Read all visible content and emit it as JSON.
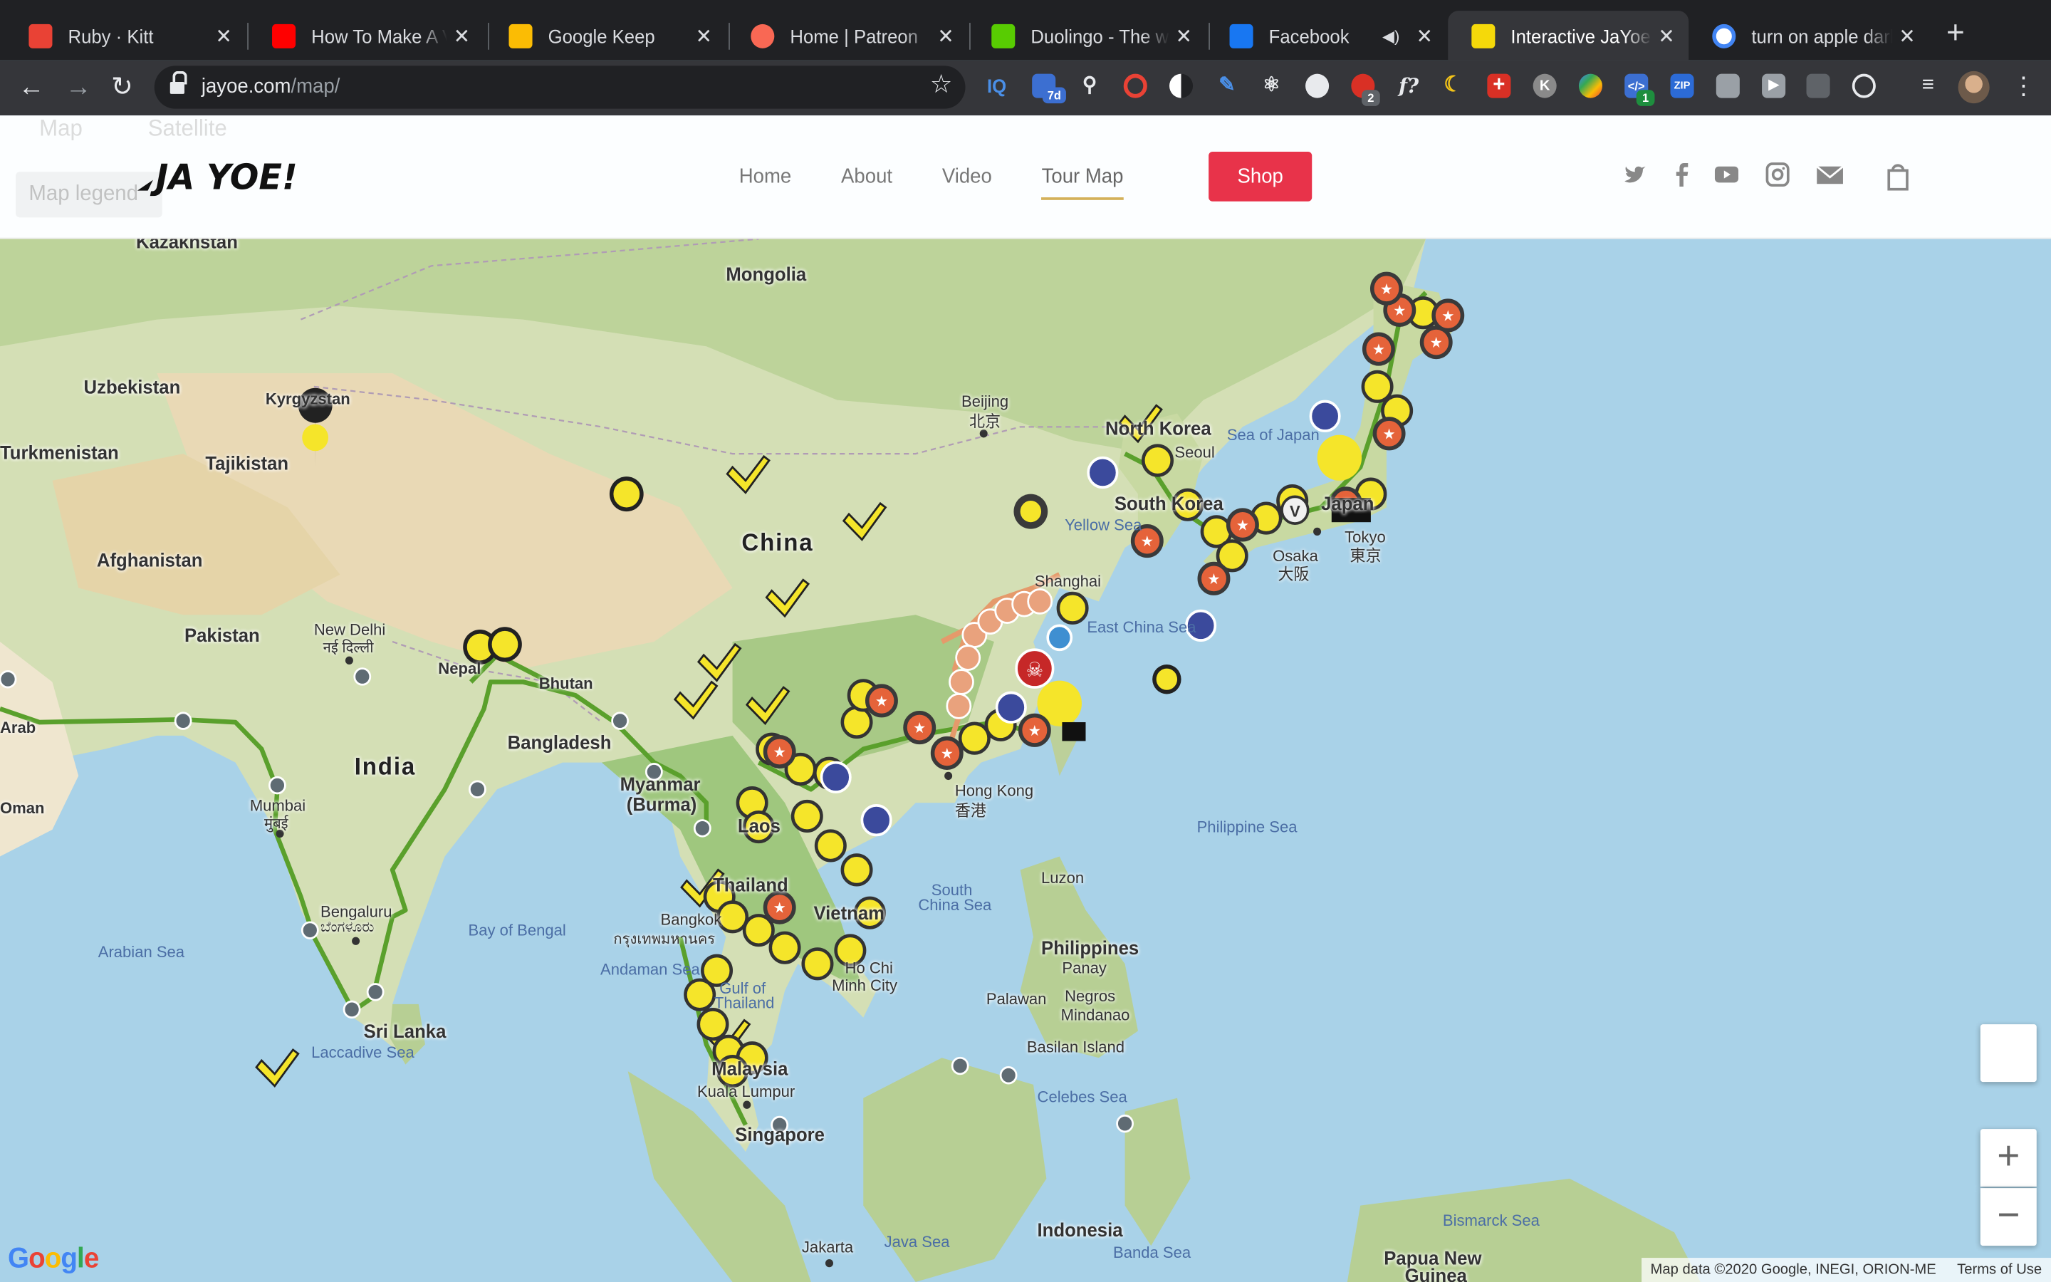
{
  "browser": {
    "tabs": [
      {
        "title": "Ruby · Kitt",
        "icon": "car-icon",
        "color": "#e94235"
      },
      {
        "title": "How To Make A Vi",
        "icon": "youtube-icon",
        "color": "#ff0000"
      },
      {
        "title": "Google Keep",
        "icon": "keep-icon",
        "color": "#fbbc04"
      },
      {
        "title": "Home | Patreon",
        "icon": "patreon-icon",
        "color": "#f96854"
      },
      {
        "title": "Duolingo - The wo",
        "icon": "duolingo-icon",
        "color": "#58cc02"
      },
      {
        "title": "Facebook",
        "icon": "facebook-icon",
        "color": "#1877f2"
      },
      {
        "title": "Interactive JaYoe",
        "icon": "jayoe-icon",
        "color": "#f5d90a"
      },
      {
        "title": "turn on apple dark",
        "icon": "google-icon",
        "color": "#4285f4"
      }
    ],
    "new_tab": "+",
    "url": {
      "domain": "jayoe.com",
      "path": "/map/"
    },
    "extensions": [
      {
        "label": "IQ",
        "color": "#4a8fe7"
      },
      {
        "label": "7d",
        "color": "#3c6fd1"
      },
      {
        "label": "ZIP",
        "color": "#2c6bd6"
      },
      {
        "label": "2",
        "color": "#d93025"
      },
      {
        "label": "1",
        "color": "#1e8e3e"
      },
      {
        "label": "K",
        "color": "#8a8a8a"
      },
      {
        "label": "f?",
        "color": "#35363a"
      }
    ]
  },
  "site": {
    "logo_text": "JA YOE!",
    "menu": [
      {
        "label": "Home"
      },
      {
        "label": "About"
      },
      {
        "label": "Video"
      },
      {
        "label": "Tour Map",
        "active": true
      }
    ],
    "shop_label": "Shop",
    "shop_color": "#e8334a",
    "social_icons": [
      "twitter-icon",
      "facebook-icon",
      "youtube-icon",
      "instagram-icon",
      "email-icon",
      "bag-icon"
    ],
    "map_tabs": [
      "Map",
      "Satellite"
    ],
    "legend_label": "Map legend"
  },
  "map": {
    "labels": [
      {
        "text": "Kazakhstan"
      },
      {
        "text": "Mongolia"
      },
      {
        "text": "Uzbekistan"
      },
      {
        "text": "Kyrgyzstan"
      },
      {
        "text": "Turkmenistan"
      },
      {
        "text": "Tajikistan"
      },
      {
        "text": "Afghanistan"
      },
      {
        "text": "Pakistan"
      },
      {
        "text": "China"
      },
      {
        "text": "India"
      },
      {
        "text": "Nepal"
      },
      {
        "text": "Bhutan"
      },
      {
        "text": "Bangladesh"
      },
      {
        "text": "Myanmar"
      },
      {
        "text": "(Burma)"
      },
      {
        "text": "Laos"
      },
      {
        "text": "Thailand"
      },
      {
        "text": "Vietnam"
      },
      {
        "text": "Malaysia"
      },
      {
        "text": "Singapore"
      },
      {
        "text": "Indonesia"
      },
      {
        "text": "Philippines"
      },
      {
        "text": "Sri Lanka"
      },
      {
        "text": "North Korea"
      },
      {
        "text": "South Korea"
      },
      {
        "text": "Japan"
      },
      {
        "text": "Beijing"
      },
      {
        "text": "北京"
      },
      {
        "text": "Shanghai"
      },
      {
        "text": "Hong Kong"
      },
      {
        "text": "香港"
      },
      {
        "text": "New Delhi"
      },
      {
        "text": "नई दिल्ली"
      },
      {
        "text": "Mumbai"
      },
      {
        "text": "मुंबई"
      },
      {
        "text": "Bengaluru"
      },
      {
        "text": "ಬೆಂಗಳೂರು"
      },
      {
        "text": "Bangkok"
      },
      {
        "text": "กรุงเทพมหานคร"
      },
      {
        "text": "Ho Chi"
      },
      {
        "text": "Minh City"
      },
      {
        "text": "Kuala Lumpur"
      },
      {
        "text": "Tokyo"
      },
      {
        "text": "東京"
      },
      {
        "text": "Osaka"
      },
      {
        "text": "大阪"
      },
      {
        "text": "Seoul"
      },
      {
        "text": "Luzon"
      },
      {
        "text": "Panay"
      },
      {
        "text": "Negros"
      },
      {
        "text": "Mindanao"
      },
      {
        "text": "Palawan"
      },
      {
        "text": "Basilan Island"
      },
      {
        "text": "Jakarta"
      },
      {
        "text": "Papua New"
      },
      {
        "text": "Guinea"
      },
      {
        "text": "Sea of Japan"
      },
      {
        "text": "Yellow Sea"
      },
      {
        "text": "East China Sea"
      },
      {
        "text": "Philippine Sea"
      },
      {
        "text": "South"
      },
      {
        "text": "China Sea"
      },
      {
        "text": "Bay of Bengal"
      },
      {
        "text": "Arabian Sea"
      },
      {
        "text": "Andaman Sea"
      },
      {
        "text": "Gulf of"
      },
      {
        "text": "Thailand"
      },
      {
        "text": "Laccadive Sea"
      },
      {
        "text": "Celebes Sea"
      },
      {
        "text": "Java Sea"
      },
      {
        "text": "Banda Sea"
      },
      {
        "text": "Bismarck Sea"
      },
      {
        "text": "Arab"
      },
      {
        "text": "Oman"
      }
    ],
    "google_logo": "Google",
    "attribution": "Map data ©2020 Google, INEGI, ORION-ME",
    "terms": "Terms of Use",
    "zoom_in": "+",
    "zoom_out": "−",
    "route_color": "#5aa02c",
    "marker_colors": {
      "yellow": "#f5e52a",
      "star": "#e5633a",
      "boat": "#3b4a9c",
      "dark": "#333333",
      "skull": "#c62828"
    }
  }
}
